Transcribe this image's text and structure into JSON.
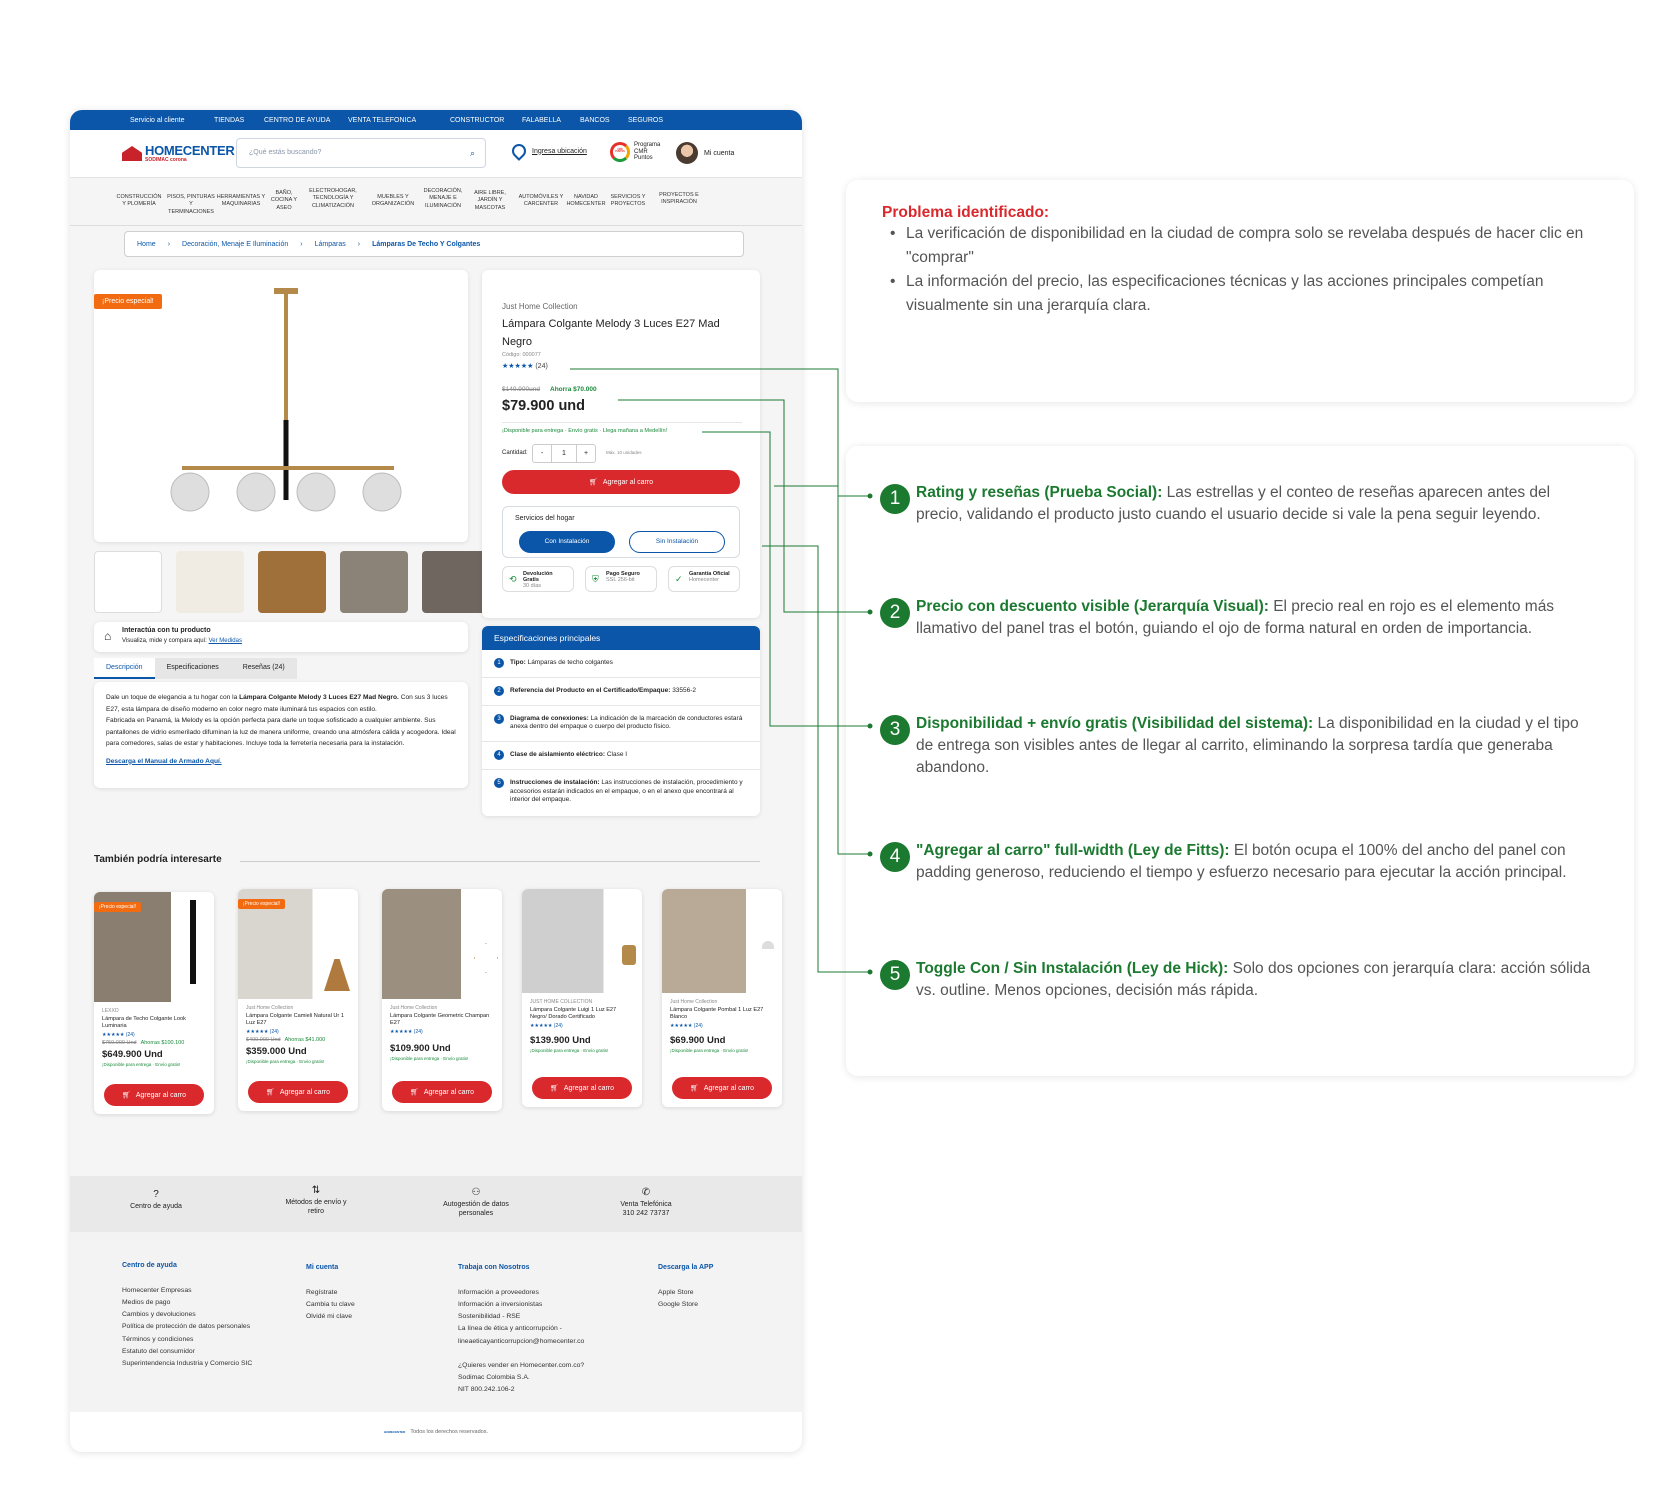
{
  "topbar": [
    "Servicio al cliente",
    "TIENDAS",
    "CENTRO DE AYUDA",
    "VENTA TELEFONICA",
    "CONSTRUCTOR",
    "FALABELLA",
    "BANCOS",
    "SEGUROS"
  ],
  "header": {
    "logo": "HOMECENTER",
    "logo_sub": "SODIMAC corona",
    "search_placeholder": "¿Qué estás buscando?",
    "location": "Ingresa ubicación",
    "cmr": "Programa CMR Puntos",
    "cmr_badge": "CMR PUNTOS",
    "account": "Mi cuenta"
  },
  "categories": [
    "CONSTRUCCIÓN Y PLOMERÍA",
    "PISOS, PINTURAS Y TERMINACIONES",
    "HERRAMIENTAS Y MAQUINARIAS",
    "BAÑO, COCINA Y ASEO",
    "ELECTROHOGAR, TECNOLOGÍA Y CLIMATIZACIÓN",
    "MUEBLES Y ORGANIZACIÓN",
    "DECORACIÓN, MENAJE E ILUMINACIÓN",
    "AIRE LIBRE, JARDÍN Y MASCOTAS",
    "AUTOMÓVILES Y CARCENTER",
    "NAVIDAD HOMECENTER",
    "SERVICIOS Y PROYECTOS",
    "PROYECTOS E INSPIRACIÓN"
  ],
  "breadcrumb": [
    "Home",
    "Decoración, Menaje E Iluminación",
    "Lámparas",
    "Lámparas De Techo Y Colgantes"
  ],
  "product": {
    "badge": "¡Precio especial!",
    "brand": "Just Home Collection",
    "title": "Lámpara Colgante Melody 3 Luces E27 Mad Negro",
    "code": "Código: 000077",
    "stars": "★★★★★",
    "reviews": "(24)",
    "old_price": "$149.900und",
    "savings": "Ahorra $70.000",
    "price": "$79.900 und",
    "availability": "¡Disponible para entrega · Envío gratis · Llega mañana a Medellín!",
    "qty_label": "Cantidad:",
    "qty_minus": "-",
    "qty": "1",
    "qty_plus": "+",
    "qty_max": "Máx. 10 unidades",
    "add_to_cart": "Agregar al carro",
    "services_title": "Servicios del hogar",
    "with_install": "Con Instalación",
    "without_install": "Sin Instalación",
    "guarantees": [
      {
        "t": "Devolución Gratis",
        "s": "30 días"
      },
      {
        "t": "Pago Seguro",
        "s": "SSL 256-bit"
      },
      {
        "t": "Garantía Oficial",
        "s": "Homecenter"
      }
    ],
    "interact_title": "Interactúa con tu producto",
    "interact_text": "Visualiza, mide y compara aquí:",
    "interact_link": "Ver Medidas"
  },
  "tabs": [
    "Descripción",
    "Especificaciones",
    "Reseñas (24)"
  ],
  "description": {
    "p1_a": "Dale un toque de elegancia a tu hogar con la",
    "p1_bold": "Lámpara Colgante Melody 3 Luces E27 Mad Negro.",
    "p1_b": "Con sus 3 luces E27, esta lámpara de diseño moderno en color negro mate iluminará tus espacios con estilo.",
    "p2": "Fabricada en Panamá, la Melody es la opción perfecta para darle un toque sofisticado a cualquier ambiente. Sus pantallones de vidrio esmerilado difuminan la luz de manera uniforme, creando una atmósfera cálida y acogedora. Ideal para comedores, salas de estar y habitaciones. Incluye toda la ferretería necesaria para la instalación.",
    "link": "Descarga el Manual de Armado Aquí."
  },
  "specs": {
    "title": "Especificaciones principales",
    "rows": [
      {
        "k": "Tipo:",
        "v": "Lámparas de techo colgantes"
      },
      {
        "k": "Referencia del Producto en el Certificado/Empaque:",
        "v": "33556-2"
      },
      {
        "k": "Diagrama de conexiones:",
        "v": "La indicación de la marcación de conductores estará anexa dentro del empaque o cuerpo del producto físico."
      },
      {
        "k": "Clase de aislamiento eléctrico:",
        "v": "Clase I"
      },
      {
        "k": "Instrucciones de instalación:",
        "v": "Las instrucciones de instalación, procedimiento y accesorios estarán indicados en el empaque, o en el anexo que encontrará al interior del empaque."
      }
    ]
  },
  "related": {
    "title": "También podría interesarte",
    "items": [
      {
        "badge": "¡Precio especial!",
        "brand": "LEXXO",
        "name": "Lámpara de Techo Colgante Look Luminaria",
        "stars": "★★★★★ (24)",
        "old": "$750.000 Und",
        "save": "Ahorras $100.100",
        "price": "$649.900 Und",
        "ship": "¡Disponible para entrega · Envío gratis!",
        "add": "Agregar al carro"
      },
      {
        "badge": "¡Precio especial!",
        "brand": "Just Home Collection",
        "name": "Lámpara Colgante Camieli Natural Ur 1 Luz E27",
        "stars": "★★★★★ (24)",
        "old": "$400.000 Und",
        "save": "Ahorras $41.000",
        "price": "$359.000 Und",
        "ship": "¡Disponible para entrega · Envío gratis!",
        "add": "Agregar al carro"
      },
      {
        "badge": "",
        "brand": "Just Home Collection",
        "name": "Lámpara Colgante Geometric Champan E27",
        "stars": "★★★★★ (24)",
        "old": "",
        "save": "",
        "price": "$109.900 Und",
        "ship": "¡Disponible para entrega · Envío gratis!",
        "add": "Agregar al carro"
      },
      {
        "badge": "",
        "brand": "JUST HOME COLLECTION",
        "name": "Lámpara Colgante Luigi 1 Luz E27 Negro/ Dorado Certificado",
        "stars": "★★★★★ (24)",
        "old": "",
        "save": "",
        "price": "$139.900 Und",
        "ship": "¡Disponible para entrega · Envío gratis!",
        "add": "Agregar al carro"
      },
      {
        "badge": "",
        "brand": "Just Home Collection",
        "name": "Lámpara Colgante Pombal 1 Luz E27 Blanco",
        "stars": "★★★★★ (24)",
        "old": "",
        "save": "",
        "price": "$69.900 Und",
        "ship": "¡Disponible para entrega · Envío gratis!",
        "add": "Agregar al carro"
      }
    ]
  },
  "helpbar": [
    {
      "label": "Centro de ayuda",
      "icon": "question-icon"
    },
    {
      "label": "Métodos de envío y retiro",
      "icon": "shipping-icon"
    },
    {
      "label": "Autogestión de datos personales",
      "icon": "user-data-icon"
    },
    {
      "label": "Venta Telefónica\n310 242 73737",
      "icon": "phone-icon"
    }
  ],
  "footer": {
    "cols": [
      {
        "title": "Centro de ayuda",
        "items": [
          "Homecenter Empresas",
          "Medios de pago",
          "Cambios y devoluciones",
          "Política de protección de datos personales",
          "Términos y condiciones",
          "Estatuto del consumidor",
          "Superintendencia Industria y Comercio SIC"
        ]
      },
      {
        "title": "Mi cuenta",
        "items": [
          "Regístrate",
          "Cambia tu clave",
          "Olvidé mi clave"
        ]
      },
      {
        "title": "Trabaja con Nosotros",
        "items": [
          "Información a proveedores",
          "Información a inversionistas",
          "Sostenibilidad - RSE",
          "La línea de ética y anticorrupción -",
          "lineaeticayanticorrupcion@homecenter.co",
          "",
          "¿Quieres vender en Homecenter.com.co?",
          "Sodimac Colombia S.A.",
          "NIT 800.242.106-2"
        ]
      },
      {
        "title": "Descarga la APP",
        "items": [
          "Apple Store",
          "Google Store"
        ]
      }
    ],
    "copyright": "Todos los derechos reservados.",
    "copyright_logo": "HOMECENTER"
  },
  "problem": {
    "title": "Problema identificado:",
    "items": [
      "La verificación de disponibilidad en la ciudad de compra solo se revelaba después de hacer clic en \"comprar\"",
      "La información del precio, las especificaciones técnicas y las acciones principales competían visualmente sin una jerarquía clara."
    ]
  },
  "points": [
    {
      "n": "1",
      "title": "Rating y reseñas (Prueba Social):",
      "text": " Las estrellas y el conteo de reseñas aparecen antes del precio, validando el producto justo cuando el usuario decide si vale la pena seguir leyendo."
    },
    {
      "n": "2",
      "title": "Precio con descuento visible (Jerarquía Visual):",
      "text": " El precio real en rojo es el elemento más llamativo del panel tras el botón, guiando el ojo de forma natural en orden de importancia."
    },
    {
      "n": "3",
      "title": "Disponibilidad + envío gratis (Visibilidad del sistema):",
      "text": " La disponibilidad en la ciudad y el tipo de entrega son visibles antes de llegar al carrito, eliminando la sorpresa tardía que generaba abandono."
    },
    {
      "n": "4",
      "title": "\"Agregar al carro\" full-width (Ley de Fitts):",
      "text": " El botón ocupa el 100% del ancho del panel con padding generoso, reduciendo el tiempo y esfuerzo necesario para ejecutar la acción principal."
    },
    {
      "n": "5",
      "title": "Toggle Con / Sin Instalación (Ley de Hick):",
      "text": " Solo dos opciones con jerarquía clara: acción sólida vs. outline. Menos opciones, decisión más rápida."
    }
  ],
  "colors": {
    "brand_blue": "#0b56a8",
    "cta_red": "#d9292d",
    "badge_orange": "#f26b10",
    "annotation_green": "#1b7a30",
    "problem_red": "#d9292d"
  }
}
